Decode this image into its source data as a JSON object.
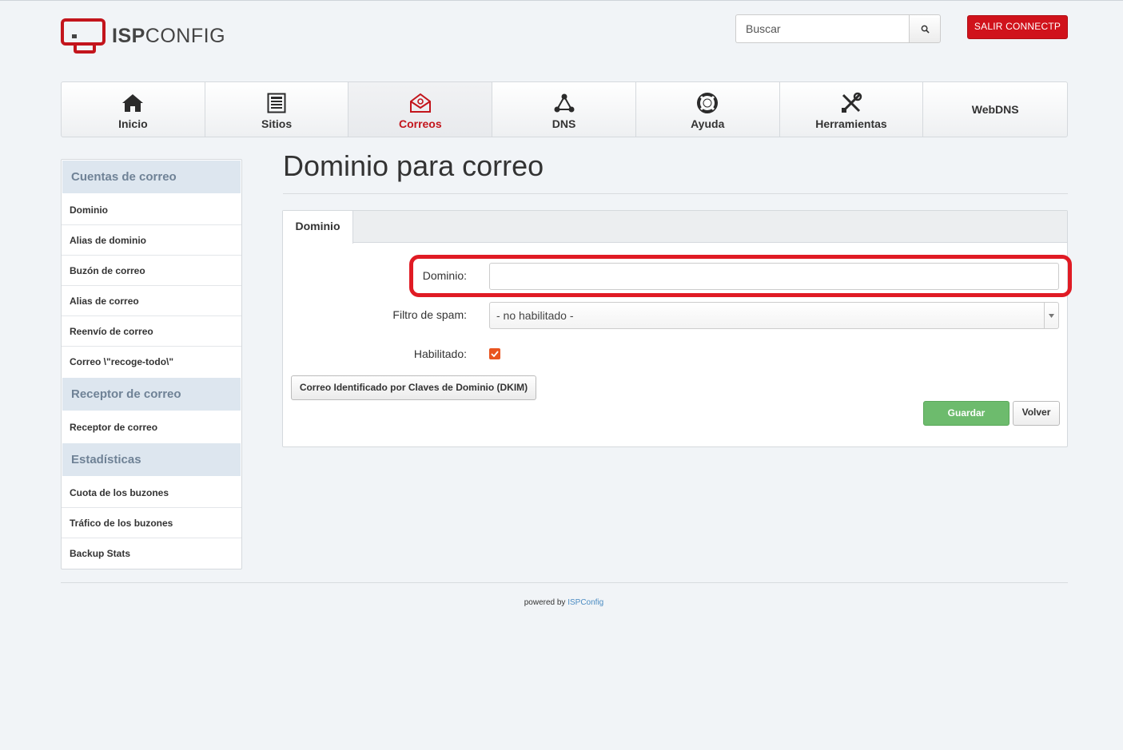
{
  "header": {
    "logo_bold": "ISP",
    "logo_light": "CONFIG",
    "search_placeholder": "Buscar",
    "logout_label": "SALIR CONNECTP",
    "brand_red": "#c3151c"
  },
  "nav": {
    "items": [
      {
        "label": "Inicio",
        "icon": "home-icon"
      },
      {
        "label": "Sitios",
        "icon": "sites-icon"
      },
      {
        "label": "Correos",
        "icon": "mail-icon",
        "active": true
      },
      {
        "label": "DNS",
        "icon": "dns-icon"
      },
      {
        "label": "Ayuda",
        "icon": "lifebuoy-icon"
      },
      {
        "label": "Herramientas",
        "icon": "tools-icon"
      },
      {
        "label": "WebDNS",
        "icon": ""
      }
    ]
  },
  "sidebar": {
    "groups": [
      {
        "title": "Cuentas de correo",
        "items": [
          "Dominio",
          "Alias de dominio",
          "Buzón de correo",
          "Alias de correo",
          "Reenvío de correo",
          "Correo \\\"recoge-todo\\\""
        ]
      },
      {
        "title": "Receptor de correo",
        "items": [
          "Receptor de correo"
        ]
      },
      {
        "title": "Estadísticas",
        "items": [
          "Cuota de los buzones",
          "Tráfico de los buzones",
          "Backup Stats"
        ]
      }
    ]
  },
  "main": {
    "title": "Dominio para correo",
    "tab": "Dominio",
    "form": {
      "domain_label": "Dominio:",
      "domain_value": "",
      "spam_label": "Filtro de spam:",
      "spam_value": "- no habilitado -",
      "enabled_label": "Habilitado:",
      "enabled": true
    },
    "dkim_button": "Correo Identificado por Claves de Dominio (DKIM)",
    "save_button": "Guardar",
    "back_button": "Volver"
  },
  "footer": {
    "prefix": "powered by",
    "link": "ISPConfig"
  }
}
